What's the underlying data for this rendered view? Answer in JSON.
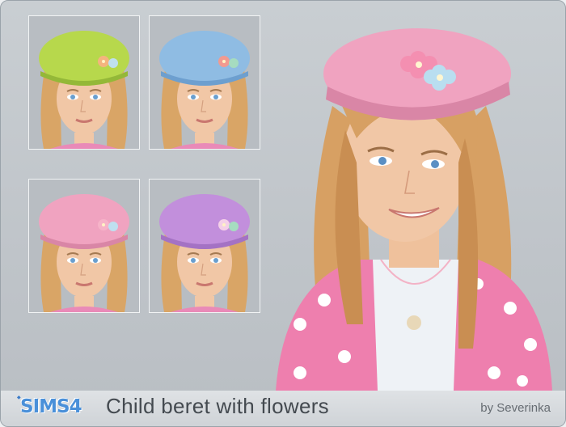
{
  "caption": {
    "logo": "SIMS4",
    "title": "Child beret with flowers",
    "author": "by Severinka"
  },
  "beret_colors": [
    "#b7d84c",
    "#8fbce3",
    "#f0a3c0",
    "#c28fdc"
  ],
  "hero_beret_color": "#f0a3c0",
  "icons": [
    "beret-variant-green",
    "beret-variant-blue",
    "beret-variant-pink",
    "beret-variant-purple",
    "child-portrait-pink-beret"
  ]
}
